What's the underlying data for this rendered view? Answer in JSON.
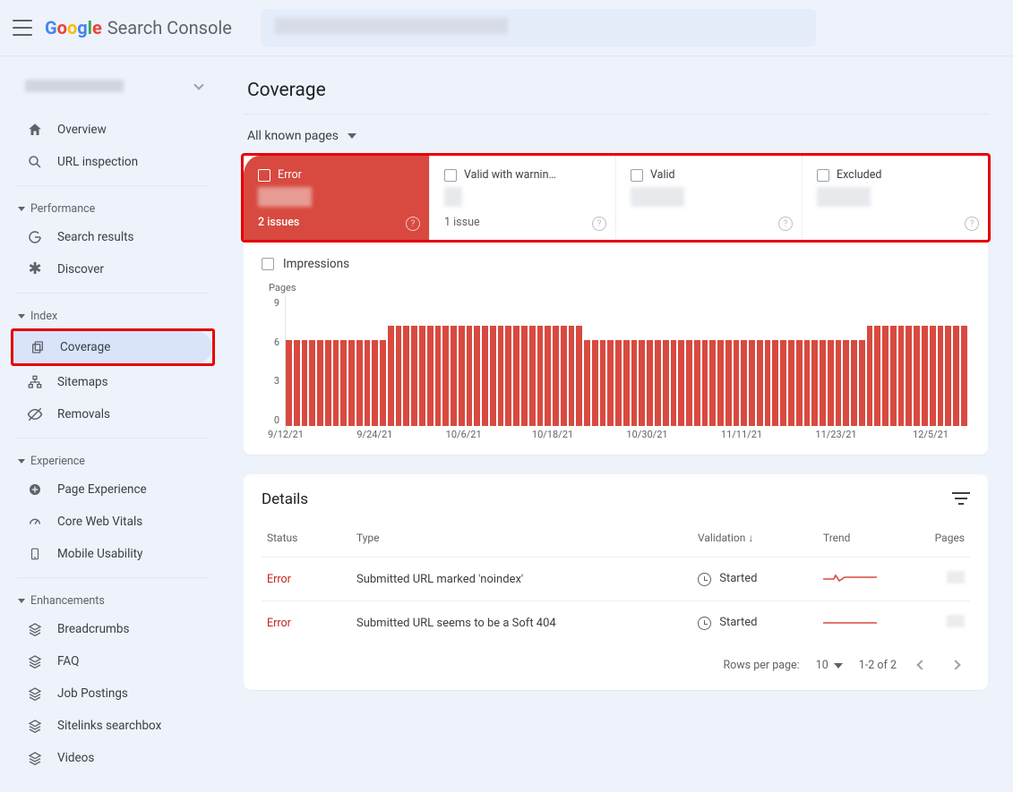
{
  "header": {
    "product_name_rest": "Search Console"
  },
  "sidebar": {
    "items_top": [
      {
        "label": "Overview"
      },
      {
        "label": "URL inspection"
      }
    ],
    "group_performance": {
      "title": "Performance",
      "items": [
        {
          "label": "Search results"
        },
        {
          "label": "Discover"
        }
      ]
    },
    "group_index": {
      "title": "Index",
      "items": [
        {
          "label": "Coverage"
        },
        {
          "label": "Sitemaps"
        },
        {
          "label": "Removals"
        }
      ]
    },
    "group_experience": {
      "title": "Experience",
      "items": [
        {
          "label": "Page Experience"
        },
        {
          "label": "Core Web Vitals"
        },
        {
          "label": "Mobile Usability"
        }
      ]
    },
    "group_enhancements": {
      "title": "Enhancements",
      "items": [
        {
          "label": "Breadcrumbs"
        },
        {
          "label": "FAQ"
        },
        {
          "label": "Job Postings"
        },
        {
          "label": "Sitelinks searchbox"
        },
        {
          "label": "Videos"
        }
      ]
    }
  },
  "page": {
    "title": "Coverage",
    "filter_label": "All known pages",
    "tabs": [
      {
        "label": "Error",
        "issues": "2 issues",
        "checked": true
      },
      {
        "label": "Valid with warnin…",
        "issues": "1 issue",
        "checked": false
      },
      {
        "label": "Valid",
        "issues": "",
        "checked": false
      },
      {
        "label": "Excluded",
        "issues": "",
        "checked": false
      }
    ],
    "impressions_label": "Impressions"
  },
  "details": {
    "title": "Details",
    "columns": {
      "status": "Status",
      "type": "Type",
      "validation": "Validation",
      "trend": "Trend",
      "pages": "Pages"
    },
    "sort_arrow": "↓",
    "rows": [
      {
        "status": "Error",
        "type": "Submitted URL marked 'noindex'",
        "validation": "Started"
      },
      {
        "status": "Error",
        "type": "Submitted URL seems to be a Soft 404",
        "validation": "Started"
      }
    ],
    "pager": {
      "rows_label": "Rows per page:",
      "rows_value": "10",
      "range": "1-2 of 2"
    }
  },
  "chart_data": {
    "type": "bar",
    "title": "",
    "ylabel": "Pages",
    "ylim": [
      0,
      9
    ],
    "yticks": [
      0,
      3,
      6,
      9
    ],
    "xticks": [
      "9/12/21",
      "9/24/21",
      "10/6/21",
      "10/18/21",
      "10/30/21",
      "11/11/21",
      "11/23/21",
      "12/5/21"
    ],
    "values": [
      6,
      6,
      6,
      6,
      6,
      6,
      6,
      6,
      6,
      6,
      6,
      6,
      6,
      7,
      7,
      7,
      7,
      7,
      7,
      7,
      7,
      7,
      7,
      7,
      7,
      7,
      7,
      7,
      7,
      7,
      7,
      7,
      7,
      7,
      7,
      7,
      7,
      7,
      6,
      6,
      6,
      6,
      6,
      6,
      6,
      6,
      6,
      6,
      6,
      6,
      6,
      6,
      6,
      6,
      6,
      6,
      6,
      6,
      6,
      6,
      6,
      6,
      6,
      6,
      6,
      6,
      6,
      6,
      6,
      6,
      6,
      6,
      6,
      6,
      7,
      7,
      7,
      7,
      7,
      7,
      7,
      7,
      7,
      7,
      7,
      7,
      7
    ]
  }
}
